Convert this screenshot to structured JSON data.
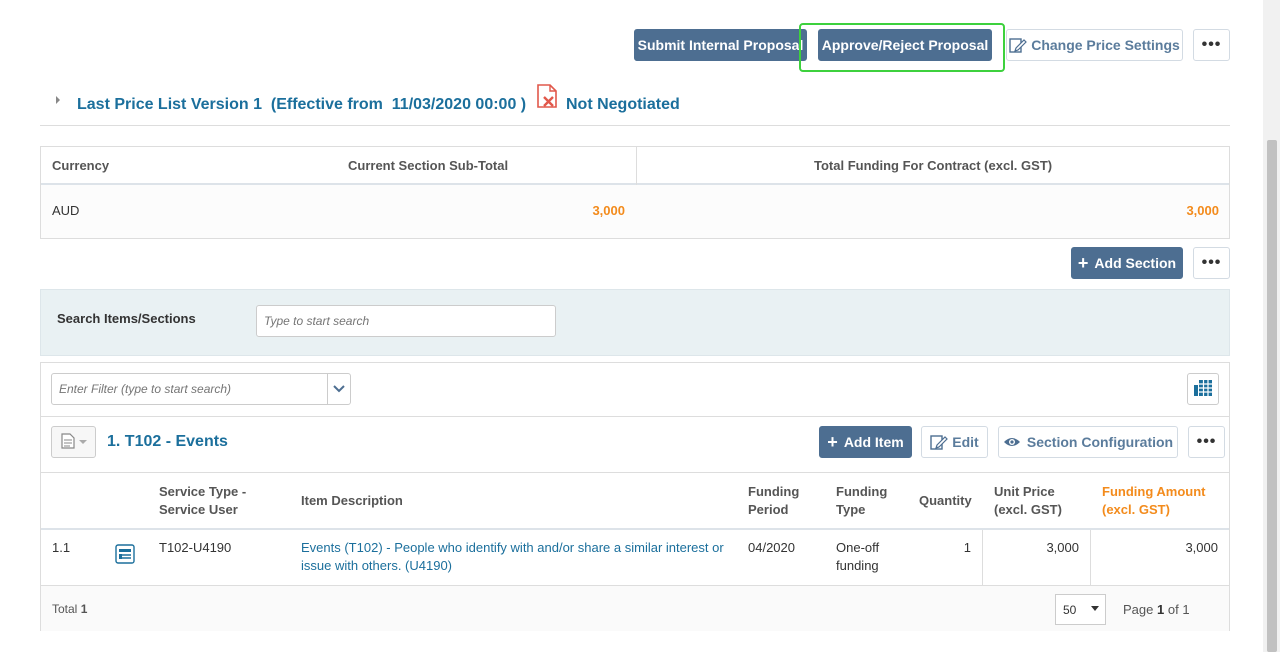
{
  "toolbar": {
    "submit_internal": "Submit Internal Proposal",
    "approve_reject": "Approve/Reject Proposal",
    "change_price": "Change Price Settings",
    "more": "•••"
  },
  "price_list": {
    "title": "Last Price List Version 1  (Effective from  11/03/2020 00:00 )",
    "status": "Not Negotiated"
  },
  "summary": {
    "headers": [
      "Currency",
      "Current Section Sub-Total",
      "Total Funding For Contract (excl. GST)"
    ],
    "currency": "AUD",
    "subtotal": "3,000",
    "total_funding": "3,000"
  },
  "add_section": {
    "label": "Add Section",
    "more": "•••"
  },
  "search": {
    "label": "Search Items/Sections",
    "placeholder": "Type to start search"
  },
  "filter": {
    "placeholder": "Enter Filter (type to start search)"
  },
  "section": {
    "title": "1. T102 - Events",
    "add_item": "Add Item",
    "edit": "Edit",
    "configuration": "Section Configuration",
    "more": "•••"
  },
  "table": {
    "headers": {
      "service_type": [
        "Service Type -",
        "Service User"
      ],
      "item_description": "Item Description",
      "funding_period": [
        "Funding",
        "Period"
      ],
      "funding_type": [
        "Funding",
        "Type"
      ],
      "quantity": "Quantity",
      "unit_price": [
        "Unit Price",
        "(excl. GST)"
      ],
      "funding_amount": [
        "Funding Amount",
        "(excl. GST)"
      ]
    },
    "rows": [
      {
        "num": "1.1",
        "service": "T102-U4190",
        "description": [
          "Events (T102) - People who identify with and/or share a similar interest or",
          "issue with others. (U4190)"
        ],
        "period": "04/2020",
        "type": [
          "One-off",
          "funding"
        ],
        "quantity": "1",
        "unit_price": "3,000",
        "amount": "3,000"
      }
    ]
  },
  "footer": {
    "total_label": "Total",
    "total_value": "1",
    "page_size": "50",
    "page_prefix": "Page",
    "page_current": "1",
    "page_of": "of 1"
  }
}
